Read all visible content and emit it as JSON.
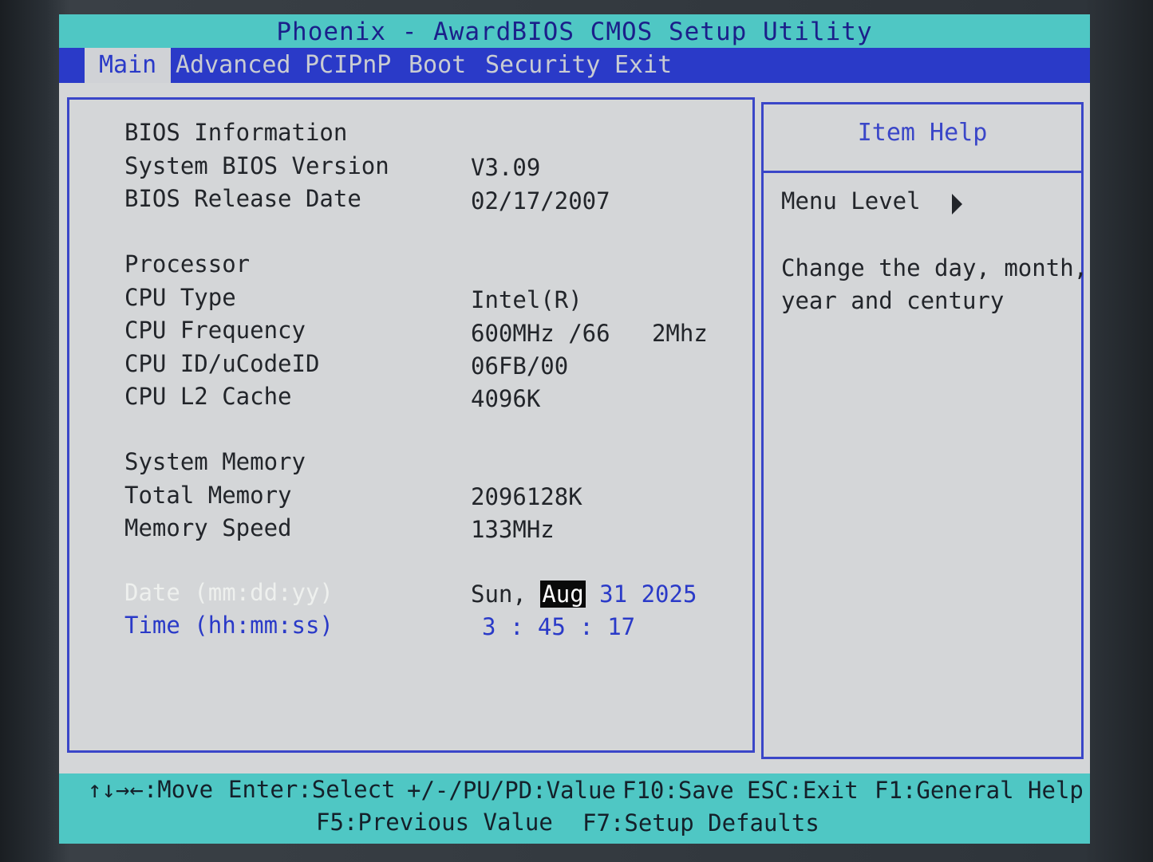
{
  "title": "Phoenix - AwardBIOS CMOS Setup Utility",
  "menu": [
    {
      "label": "Main",
      "active": true
    },
    {
      "label": "Advanced",
      "active": false
    },
    {
      "label": "PCIPnP",
      "active": false
    },
    {
      "label": "Boot",
      "active": false
    },
    {
      "label": "Security",
      "active": false
    },
    {
      "label": "Exit",
      "active": false
    }
  ],
  "main": {
    "bios_info_header": "BIOS Information",
    "bios_version": {
      "label": "System BIOS Version",
      "value": "V3.09"
    },
    "bios_date": {
      "label": "BIOS Release Date",
      "value": "02/17/2007"
    },
    "processor_header": "Processor",
    "cpu_type": {
      "label": "CPU Type",
      "value": "Intel(R)"
    },
    "cpu_freq": {
      "label": "CPU Frequency",
      "value": "600MHz /66   2Mhz"
    },
    "cpu_id": {
      "label": "CPU ID/uCodeID",
      "value": "06FB/00"
    },
    "cpu_cache": {
      "label": "CPU L2 Cache",
      "value": "4096K"
    },
    "memory_header": "System Memory",
    "total_memory": {
      "label": "Total Memory",
      "value": "2096128K"
    },
    "memory_speed": {
      "label": "Memory Speed",
      "value": "133MHz"
    },
    "date": {
      "label": "Date (mm:dd:yy)",
      "day": "Sun,",
      "month": "Aug",
      "date": "31",
      "year": "2025"
    },
    "time": {
      "label": "Time (hh:mm:ss)",
      "hh": "3",
      "mm": "45",
      "ss": "17",
      "sep": ":"
    }
  },
  "help": {
    "title": "Item Help",
    "menu_level": "Menu Level",
    "line1": "Change the day, month,",
    "line2": "year and century"
  },
  "footer": {
    "move": "↑↓→←:Move",
    "select": "Enter:Select",
    "value": "+/-/PU/PD:Value",
    "save": "F10:Save",
    "exit": "ESC:Exit",
    "help": "F1:General Help",
    "prev": "F5:Previous Value",
    "defaults": "F7:Setup Defaults"
  },
  "colors": {
    "cyan_bar": "#4fc7c4",
    "menu_blue": "#2a3ac8",
    "panel_gray": "#d4d6d8"
  }
}
